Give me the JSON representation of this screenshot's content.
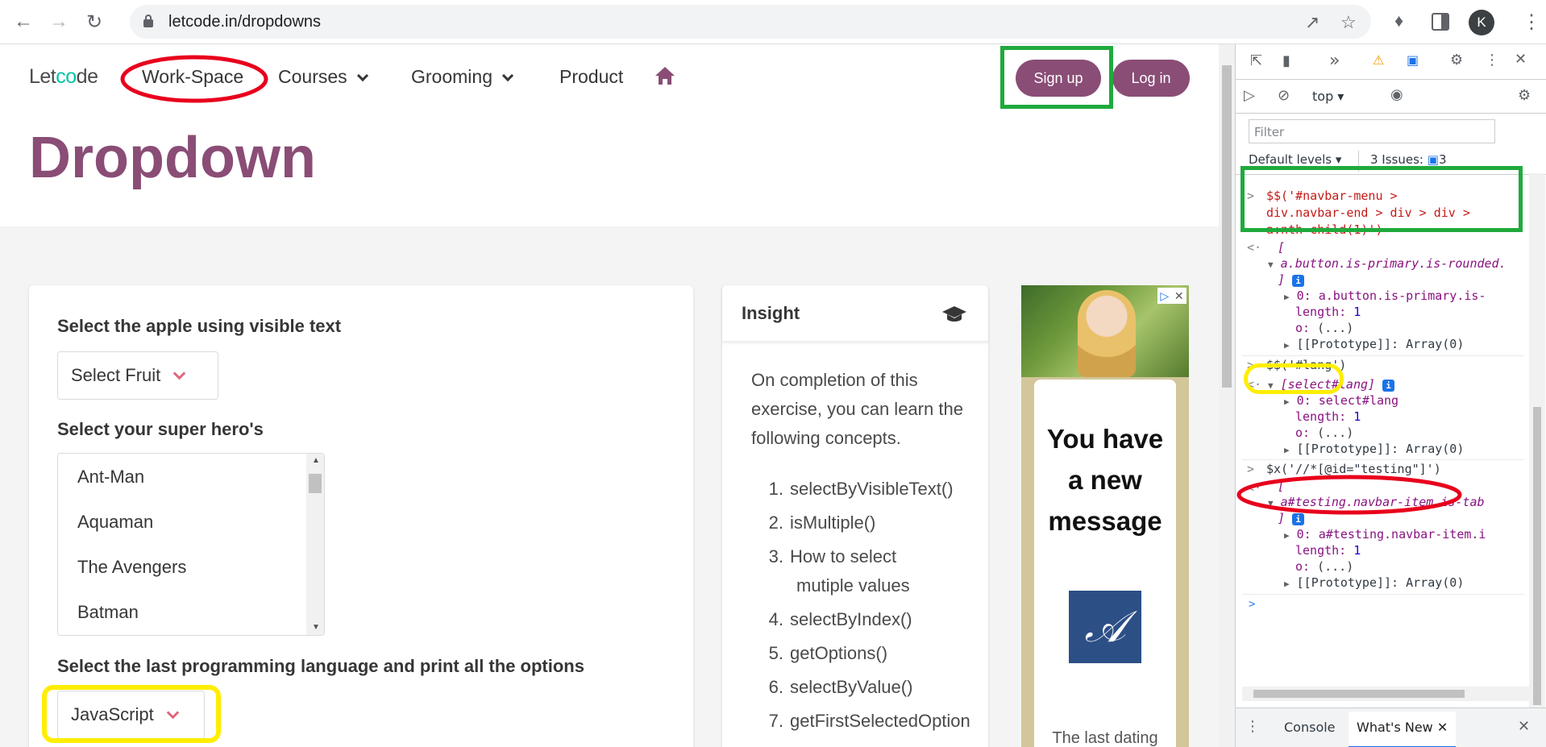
{
  "browser": {
    "url": "letcode.in/dropdowns",
    "profile_initial": "K",
    "icons": [
      "back-arrow-icon",
      "forward-arrow-icon",
      "reload-icon",
      "lock-icon",
      "share-icon",
      "star-icon",
      "extensions-icon",
      "side-panel-icon"
    ]
  },
  "navbar": {
    "logo_prefix": "Let",
    "logo_accent": "co",
    "logo_suffix": "de",
    "items": [
      "Work-Space",
      "Courses",
      "Grooming",
      "Product"
    ],
    "signup": "Sign up",
    "login": "Log in"
  },
  "hero": {
    "title": "Dropdown"
  },
  "form": {
    "fruit_label": "Select the apple using visible text",
    "fruit_value": "Select Fruit",
    "hero_label": "Select your super hero's",
    "heroes": [
      "Ant-Man",
      "Aquaman",
      "The Avengers",
      "Batman"
    ],
    "lang_label": "Select the last programming language and print all the options",
    "lang_value": "JavaScript"
  },
  "insight": {
    "title": "Insight",
    "intro": "On completion of this exercise, you can learn the following concepts.",
    "concepts": [
      {
        "n": "1.",
        "line1": "selectByVisibleText()",
        "line2": ""
      },
      {
        "n": "2.",
        "line1": "isMultiple()",
        "line2": ""
      },
      {
        "n": "3.",
        "line1": "How to select",
        "line2": "mutiple values"
      },
      {
        "n": "4.",
        "line1": "selectByIndex()",
        "line2": ""
      },
      {
        "n": "5.",
        "line1": "getOptions()",
        "line2": ""
      },
      {
        "n": "6.",
        "line1": "selectByValue()",
        "line2": ""
      },
      {
        "n": "7.",
        "line1": "getFirstSelectedOption",
        "line2": ""
      }
    ]
  },
  "ad": {
    "msg1": "You have",
    "msg2": "a new",
    "msg3": "message",
    "teaser": "The last dating"
  },
  "devtools": {
    "context": "top",
    "filter_placeholder": "Filter",
    "levels": "Default levels",
    "issues_label": "3 Issues:",
    "issues_count": "3",
    "cmd1_a": "$$('#navbar-menu >",
    "cmd1_b": "div.navbar-end > div > div >",
    "cmd1_c": "a:nth-child(1)')",
    "res1_open": "[",
    "res1_head": "a.button.is-primary.is-rounded.",
    "res1_close": "]",
    "res1_item": "a.button.is-primary.is-",
    "cmd2": "$$('#lang')",
    "res2_head": "[select#lang]",
    "res2_item": "select#lang",
    "cmd3": "$x('//*[@id=\"testing\"]')",
    "res3_open": "[",
    "res3_head": "a#testing.navbar-item.is-tab",
    "res3_close": "]",
    "res3_item": "a#testing.navbar-item.i",
    "idx0": "0:",
    "length_key": "length:",
    "length_val": "1",
    "o_key": "o:",
    "o_val": "(...)",
    "proto": "[[Prototype]]: Array(0)",
    "tabs": [
      "Console",
      "What's New"
    ]
  },
  "colors": {
    "brand": "#8a4d76",
    "highlight_red": "#e8001c",
    "highlight_green": "#1faa3c",
    "highlight_yellow": "#ffee00",
    "accent_teal": "#00c4a7"
  }
}
